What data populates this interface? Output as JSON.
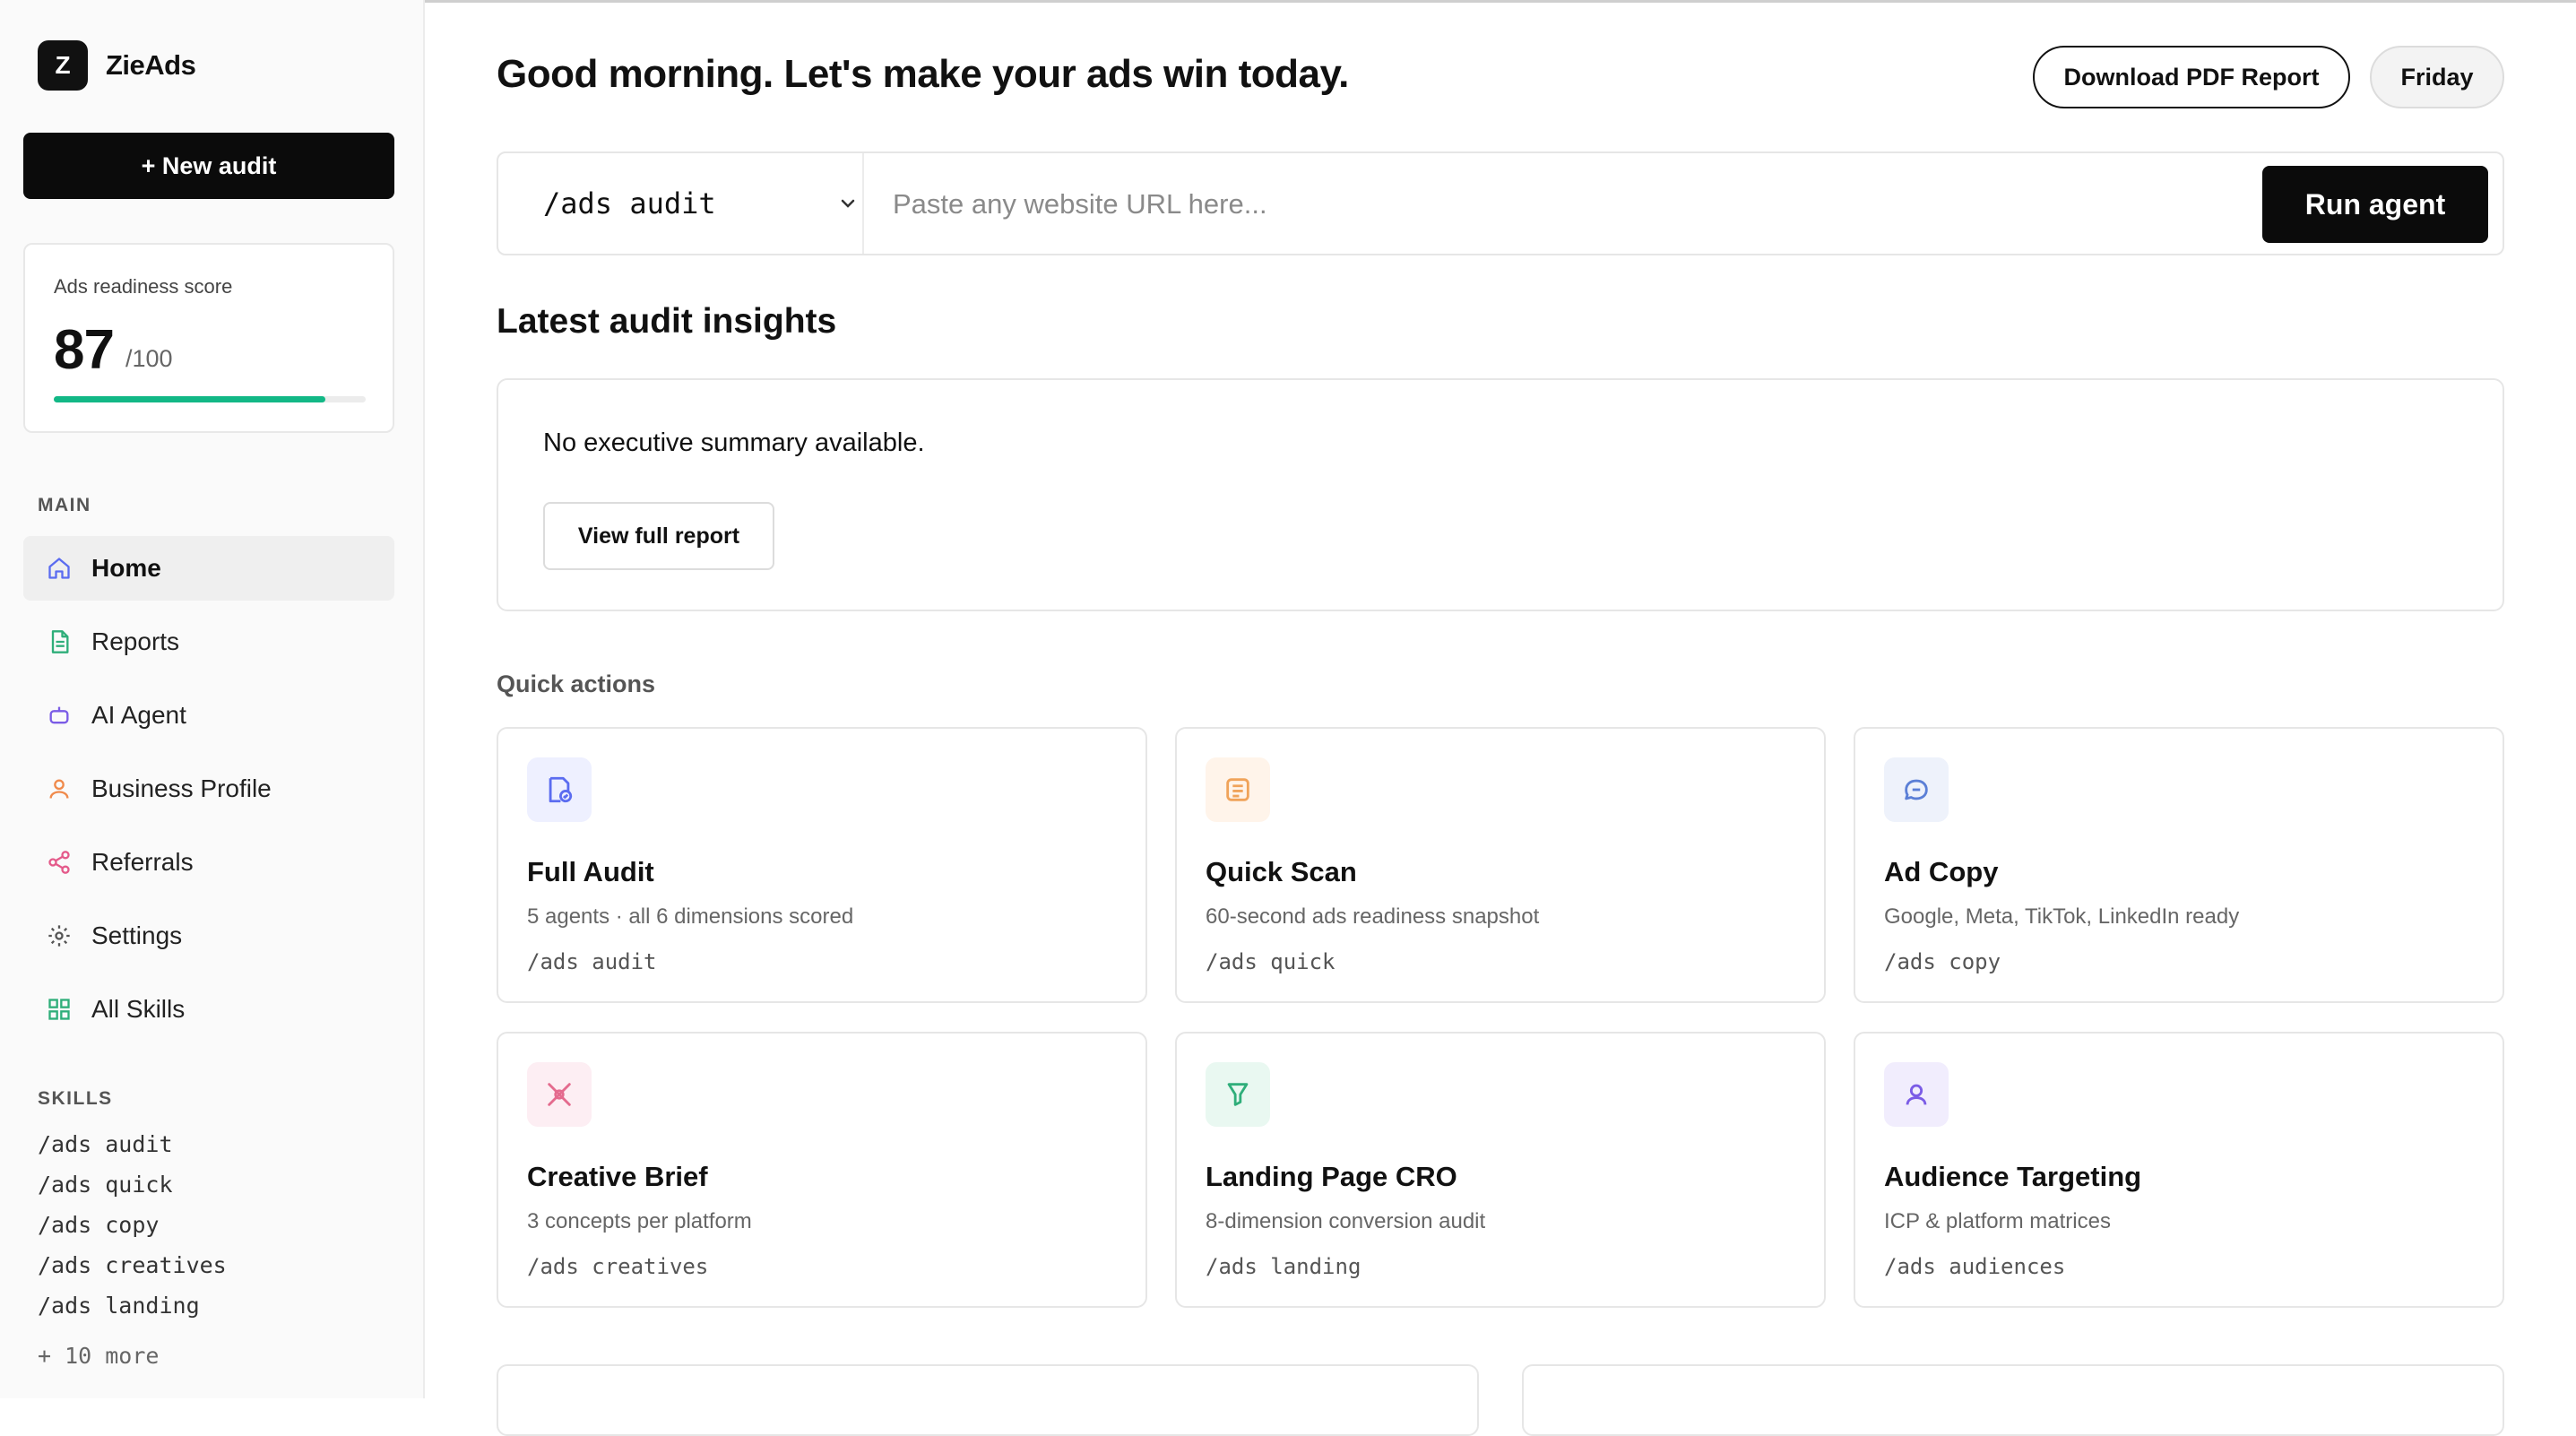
{
  "app": {
    "logo_letter": "Z",
    "name": "ZieAds"
  },
  "sidebar": {
    "new_audit_label": "+ New audit",
    "score": {
      "label": "Ads readiness score",
      "value": "87",
      "max": "/100",
      "fraction": 0.87
    },
    "main_section_label": "MAIN",
    "nav": [
      {
        "label": "Home",
        "icon": "home-icon",
        "active": true
      },
      {
        "label": "Reports",
        "icon": "document-icon"
      },
      {
        "label": "AI Agent",
        "icon": "robot-icon"
      },
      {
        "label": "Business Profile",
        "icon": "user-icon"
      },
      {
        "label": "Referrals",
        "icon": "share-icon"
      },
      {
        "label": "Settings",
        "icon": "gear-icon"
      },
      {
        "label": "All Skills",
        "icon": "grid-icon"
      }
    ],
    "skills_section_label": "SKILLS",
    "skills": [
      "/ads audit",
      "/ads quick",
      "/ads copy",
      "/ads creatives",
      "/ads landing"
    ],
    "more_label": "+ 10 more"
  },
  "header": {
    "greeting": "Good morning. Let's make your ads win today.",
    "download_label": "Download PDF Report",
    "day_label": "Friday"
  },
  "agent": {
    "selected": "/ads audit",
    "placeholder": "Paste any website URL here...",
    "run_label": "Run agent"
  },
  "insights": {
    "heading": "Latest audit insights",
    "summary": "No executive summary available.",
    "view_label": "View full report"
  },
  "quick_actions": {
    "label": "Quick actions",
    "cards": [
      {
        "title": "Full Audit",
        "desc": "5 agents · all 6 dimensions scored",
        "cmd": "/ads audit",
        "icon": "audit-icon",
        "color": "#5b6cf0",
        "bg": "#eef0ff"
      },
      {
        "title": "Quick Scan",
        "desc": "60-second ads readiness snapshot",
        "cmd": "/ads quick",
        "icon": "scan-icon",
        "color": "#f0a35a",
        "bg": "#fff4ea"
      },
      {
        "title": "Ad Copy",
        "desc": "Google, Meta, TikTok, LinkedIn ready",
        "cmd": "/ads copy",
        "icon": "copy-icon",
        "color": "#5b7fd6",
        "bg": "#eef2fb"
      },
      {
        "title": "Creative Brief",
        "desc": "3 concepts per platform",
        "cmd": "/ads creatives",
        "icon": "creative-icon",
        "color": "#e46b8e",
        "bg": "#fdeef3"
      },
      {
        "title": "Landing Page CRO",
        "desc": "8-dimension conversion audit",
        "cmd": "/ads landing",
        "icon": "landing-icon",
        "color": "#2fae7a",
        "bg": "#e9f8f1"
      },
      {
        "title": "Audience Targeting",
        "desc": "ICP & platform matrices",
        "cmd": "/ads audiences",
        "icon": "audience-icon",
        "color": "#7b5ce6",
        "bg": "#f1edfd"
      }
    ]
  }
}
